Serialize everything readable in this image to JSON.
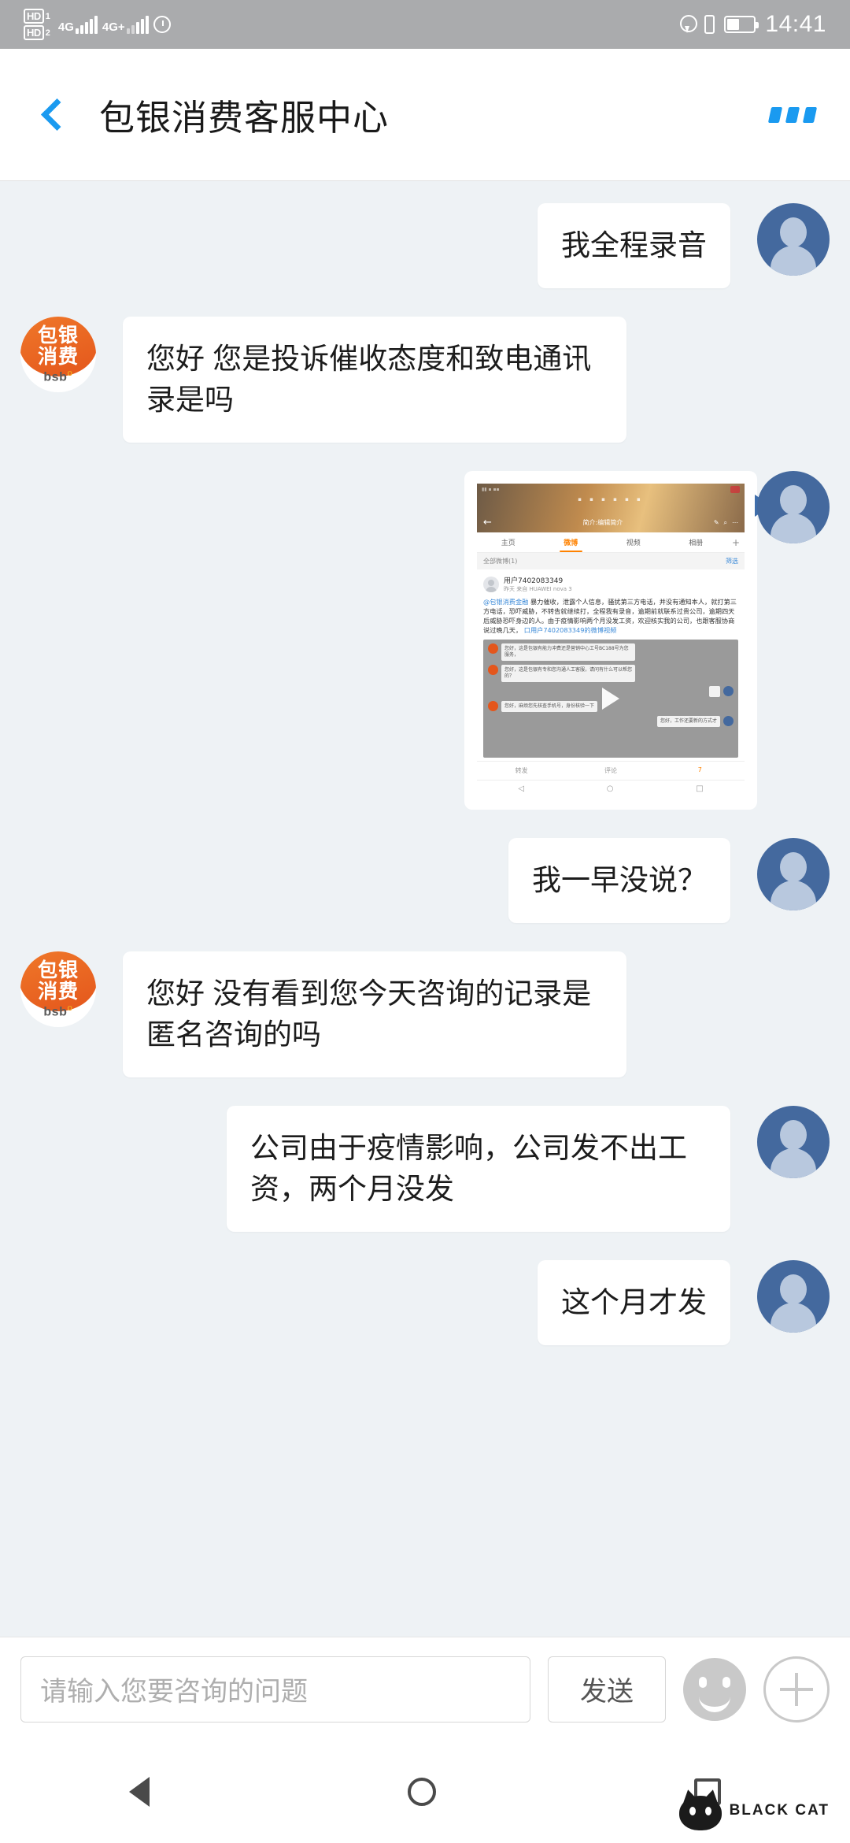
{
  "status_bar": {
    "hd_labels": [
      "HD",
      "HD"
    ],
    "sim_numbers": [
      "1",
      "2"
    ],
    "network_1": "4G",
    "network_2": "4G+",
    "alarm_icon": "alarm-clock-icon",
    "location_icon": "location-pin-icon",
    "vibrate_icon": "vibrate-icon",
    "battery_icon": "battery-icon",
    "time": "14:41"
  },
  "header": {
    "back_icon": "back-chevron-icon",
    "title": "包银消费客服中心",
    "more_icon": "more-options-icon"
  },
  "colors": {
    "accent_blue": "#1a9af0",
    "user_avatar_blue": "#44699e",
    "brand_orange": "#e4561c",
    "chat_bg": "#eef2f5"
  },
  "chat": {
    "messages": [
      {
        "id": "m1",
        "side": "me",
        "type": "text",
        "text": "我全程录音"
      },
      {
        "id": "m2",
        "side": "them",
        "type": "text",
        "text": "您好 您是投诉催收态度和致电通讯录是吗"
      },
      {
        "id": "m3",
        "side": "me",
        "type": "image",
        "alt": "微博截图"
      },
      {
        "id": "m4",
        "side": "me",
        "type": "text",
        "text": "我一早没说？"
      },
      {
        "id": "m5",
        "side": "them",
        "type": "text",
        "text": "您好 没有看到您今天咨询的记录是匿名咨询的吗"
      },
      {
        "id": "m6",
        "side": "me",
        "type": "text",
        "text": "公司由于疫情影响，公司发不出工资，两个月没发"
      },
      {
        "id": "m7",
        "side": "me",
        "type": "text",
        "text": "这个月才发"
      }
    ],
    "agent_avatar": {
      "line1": "包银",
      "line2": "消费",
      "latin": "bsb"
    }
  },
  "embedded_screenshot": {
    "app": "微博",
    "profile_bio": "简介:编辑简介",
    "tabs": [
      "主页",
      "微博",
      "视频",
      "相册"
    ],
    "active_tab": "微博",
    "add_tab_icon": "plus-icon",
    "search_icon": "search-icon",
    "more_icon": "more-dots-icon",
    "filter_label": "全部微博(1)",
    "filter_right": "筛选",
    "user_name": "用户7402083349",
    "post_meta": "昨天 来自 HUAWEI nova 3",
    "mention": "@包银消费金融",
    "post_text": "暴力催收，泄露个人信息，骚扰第三方电话，并没有通知本人，就打第三方电话，恐吓威胁，不转告就继续打，全程我有录音，逾期前就联系过贵公司，逾期四天后威胁恐吓身边的人。由于疫情影响两个月没发工资，欢迎核实我的公司，也跟客服协商说过晚几天，",
    "post_link": "口用户7402083349的微博视频",
    "video_messages": [
      "您好，这是包银有能力冲费还是营销中心工号BC188号为您服务，",
      "您好，这是包银有专和您沟通人工客服，请问有什么可以帮您的？",
      "您好，麻烦您先核查手机号，身份核验一下",
      "您好，工作还要新的方式才"
    ],
    "play_icon": "play-icon",
    "actions": [
      "转发",
      "评论",
      "7"
    ],
    "like_icon": "thumbs-up-icon",
    "nav_icons": [
      "back-triangle-icon",
      "home-circle-icon",
      "recents-square-icon"
    ]
  },
  "input_bar": {
    "placeholder": "请输入您要咨询的问题",
    "value": "",
    "send_label": "发送",
    "emoji_icon": "smiley-icon",
    "plus_icon": "plus-circle-icon"
  },
  "nav_bar": {
    "back_icon": "nav-back-icon",
    "home_icon": "nav-home-icon",
    "recents_icon": "nav-recents-icon"
  },
  "watermark": {
    "icon": "black-cat-icon",
    "text": "BLACK CAT"
  }
}
